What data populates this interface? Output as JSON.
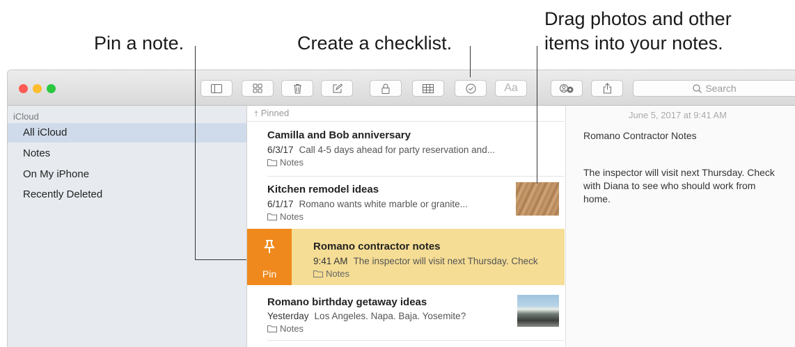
{
  "callouts": {
    "pin": "Pin a note.",
    "checklist": "Create a checklist.",
    "drag_line1": "Drag photos and other",
    "drag_line2": "items into your notes."
  },
  "toolbar": {
    "buttons": [
      "sidebar-toggle",
      "gallery-view",
      "delete",
      "compose",
      "lock",
      "table",
      "checklist",
      "format",
      "collaborate",
      "share"
    ],
    "format_label": "Aa",
    "search_placeholder": "Search"
  },
  "sidebar": {
    "header": "iCloud",
    "items": [
      {
        "label": "All iCloud",
        "selected": true
      },
      {
        "label": "Notes",
        "selected": false
      },
      {
        "label": "On My iPhone",
        "selected": false
      },
      {
        "label": "Recently Deleted",
        "selected": false
      }
    ]
  },
  "notelist": {
    "pinned_header": "Pinned",
    "notes": [
      {
        "title": "Camilla and Bob anniversary",
        "date": "6/3/17",
        "preview": "Call 4-5 days ahead for party reservation and...",
        "folder": "Notes"
      },
      {
        "title": "Kitchen remodel ideas",
        "date": "6/1/17",
        "preview": "Romano wants white marble or granite...",
        "folder": "Notes"
      },
      {
        "title": "Romano contractor notes",
        "date": "9:41 AM",
        "preview": "The inspector will visit next Thursday. Check",
        "folder": "Notes",
        "swipe_action": "Pin"
      },
      {
        "title": "Romano birthday getaway ideas",
        "date": "Yesterday",
        "preview": "Los Angeles. Napa. Baja. Yosemite?",
        "folder": "Notes"
      }
    ]
  },
  "editor": {
    "timestamp": "June 5, 2017 at 9:41 AM",
    "title_line": "Romano Contractor Notes",
    "body_line1": "The inspector will visit next Thursday. Check",
    "body_line2": "with Diana to see who should work from",
    "body_line3": "home."
  },
  "colors": {
    "accent_orange": "#f0891d",
    "selected_note": "#f5dd95",
    "sidebar_bg": "#e7ebf0",
    "sidebar_selected": "#cfdbea"
  }
}
